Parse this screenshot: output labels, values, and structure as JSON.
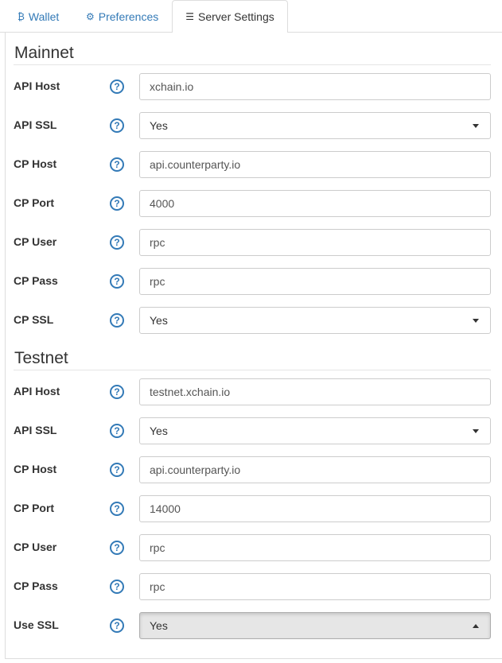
{
  "tabs": [
    {
      "label": "Wallet",
      "icon": "bitcoin-icon",
      "glyph": "₿",
      "active": false
    },
    {
      "label": "Preferences",
      "icon": "gear-icon",
      "glyph": "⚙",
      "active": false
    },
    {
      "label": "Server Settings",
      "icon": "server-list-icon",
      "glyph": "☰",
      "active": true
    }
  ],
  "help_glyph": "?",
  "mainnet": {
    "title": "Mainnet",
    "api_host": {
      "label": "API Host",
      "value": "xchain.io"
    },
    "api_ssl": {
      "label": "API SSL",
      "value": "Yes"
    },
    "cp_host": {
      "label": "CP Host",
      "value": "api.counterparty.io"
    },
    "cp_port": {
      "label": "CP Port",
      "value": "4000"
    },
    "cp_user": {
      "label": "CP User",
      "value": "rpc"
    },
    "cp_pass": {
      "label": "CP Pass",
      "value": "rpc"
    },
    "cp_ssl": {
      "label": "CP SSL",
      "value": "Yes"
    }
  },
  "testnet": {
    "title": "Testnet",
    "api_host": {
      "label": "API Host",
      "value": "testnet.xchain.io"
    },
    "api_ssl": {
      "label": "API SSL",
      "value": "Yes"
    },
    "cp_host": {
      "label": "CP Host",
      "value": "api.counterparty.io"
    },
    "cp_port": {
      "label": "CP Port",
      "value": "14000"
    },
    "cp_user": {
      "label": "CP User",
      "value": "rpc"
    },
    "cp_pass": {
      "label": "CP Pass",
      "value": "rpc"
    },
    "use_ssl": {
      "label": "Use SSL",
      "value": "Yes"
    }
  },
  "colors": {
    "link": "#337ab7",
    "border": "#cccccc",
    "text": "#333333"
  }
}
